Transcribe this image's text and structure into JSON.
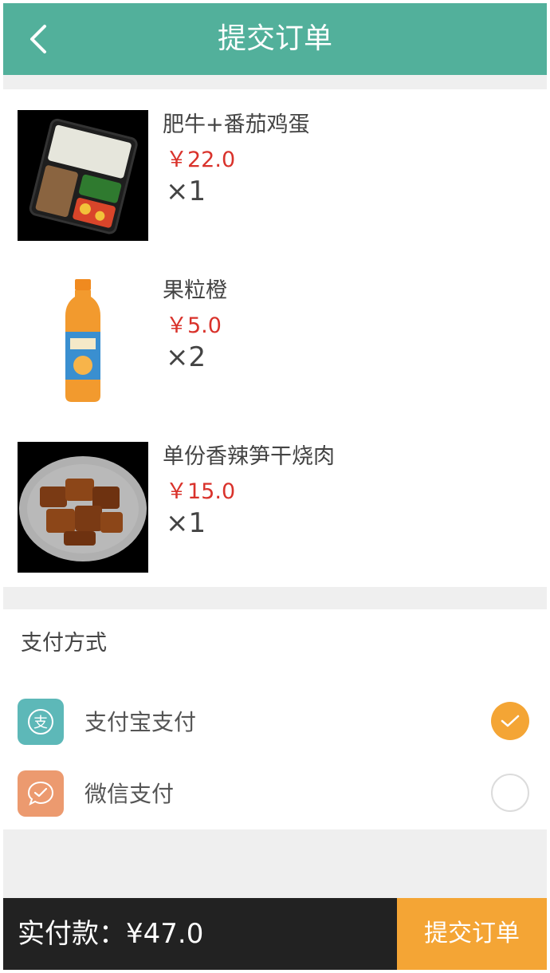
{
  "header": {
    "title": "提交订单",
    "back_icon": "chevron-left-icon"
  },
  "items": [
    {
      "name": "肥牛+番茄鸡蛋",
      "price": "￥22.0",
      "qty": "×1",
      "image": "bento-box-image"
    },
    {
      "name": "果粒橙",
      "price": "￥5.0",
      "qty": "×2",
      "image": "orange-juice-bottle-image"
    },
    {
      "name": "单份香辣笋干烧肉",
      "price": "￥15.0",
      "qty": "×1",
      "image": "braised-pork-bowl-image"
    }
  ],
  "payment": {
    "title": "支付方式",
    "methods": [
      {
        "label": "支付宝支付",
        "icon": "alipay-icon",
        "icon_color": "#5db8b8",
        "selected": true
      },
      {
        "label": "微信支付",
        "icon": "wechat-icon",
        "icon_color": "#ec9a6f",
        "selected": false
      }
    ]
  },
  "footer": {
    "total": "实付款：¥47.0",
    "submit_label": "提交订单"
  },
  "colors": {
    "header": "#52b09b",
    "accent": "#f4a535",
    "price": "#d9322b",
    "footer": "#222222"
  }
}
